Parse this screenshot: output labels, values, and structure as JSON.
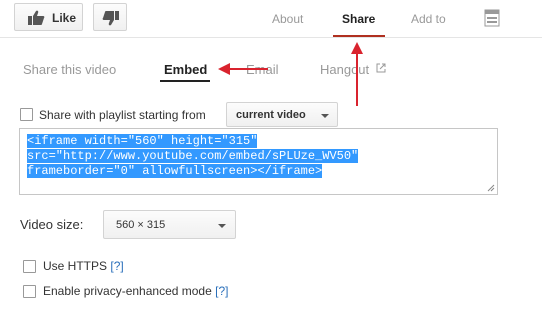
{
  "header": {
    "like_label": "Like",
    "tabs": [
      {
        "label": "About"
      },
      {
        "label": "Share"
      },
      {
        "label": "Add to"
      }
    ]
  },
  "share": {
    "subtabs": [
      {
        "label": "Share this video"
      },
      {
        "label": "Embed"
      },
      {
        "label": "Email"
      },
      {
        "label": "Hangout"
      }
    ],
    "playlist_label": "Share with playlist starting from",
    "playlist_value": "current video",
    "embed_code": [
      "<iframe width=\"560\" height=\"315\"",
      "src=\"http://www.youtube.com/embed/sPLUze_WV50\"",
      "frameborder=\"0\" allowfullscreen></iframe>"
    ],
    "video_size_label": "Video size:",
    "video_size_value": "560 × 315",
    "https_label": "Use HTTPS",
    "privacy_label": "Enable privacy-enhanced mode",
    "help_link": "[?]"
  },
  "colors": {
    "selection": "#3399ff",
    "tab_underline": "#b03020",
    "annotation_arrow": "#d9232e"
  },
  "icons": [
    "thumbs-up-icon",
    "thumbs-down-icon",
    "report-flag-icon",
    "external-link-icon",
    "chevron-down-icon",
    "resize-grip-icon"
  ]
}
